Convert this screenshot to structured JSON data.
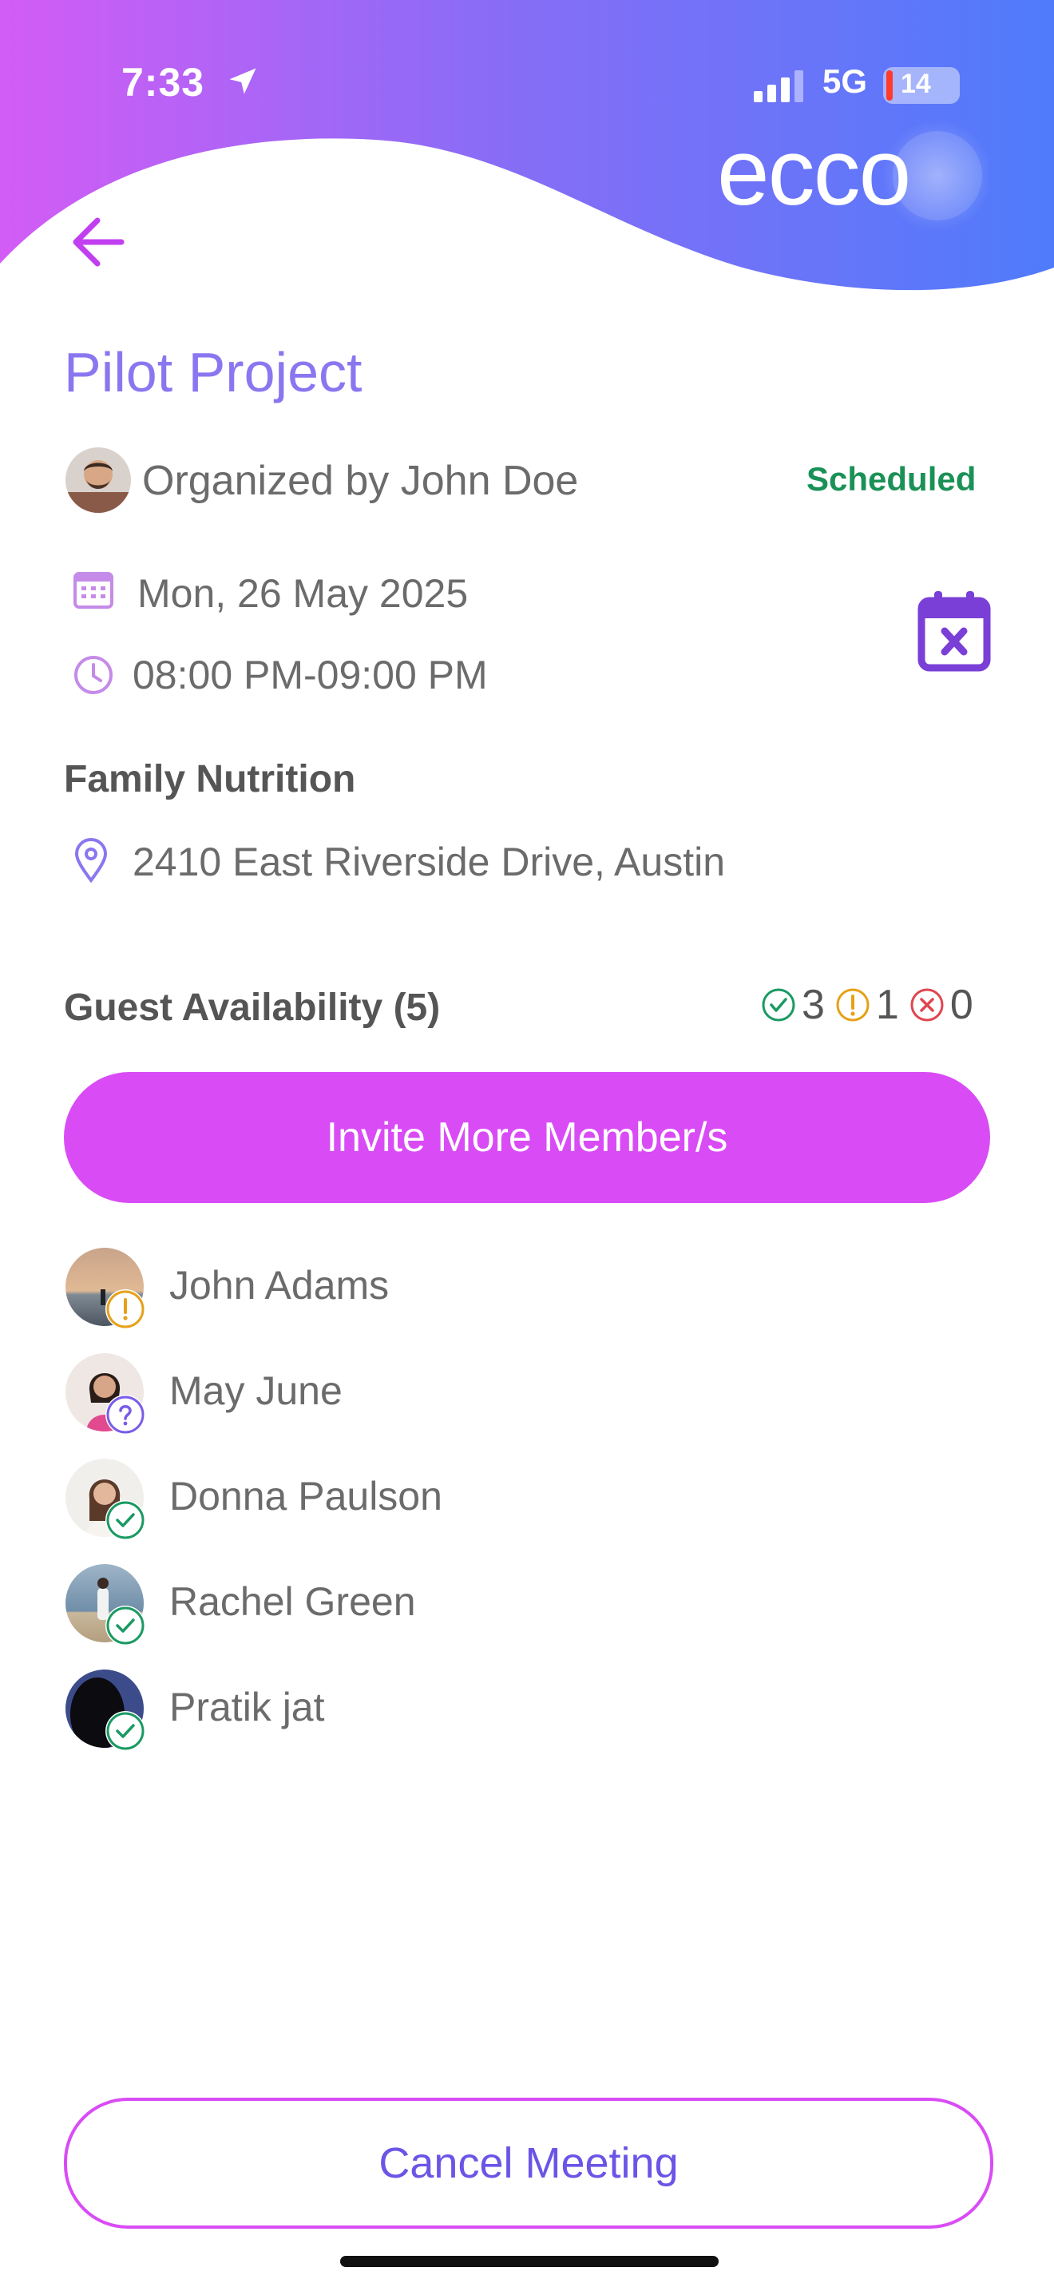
{
  "status_bar": {
    "time": "7:33",
    "network": "5G",
    "battery": "14"
  },
  "header": {
    "logo_text": "ecco",
    "back_icon": "arrow-left-icon"
  },
  "event": {
    "title": "Pilot Project",
    "organizer": "Organized by John Doe",
    "status": "Scheduled",
    "date": "Mon, 26 May 2025",
    "time": "08:00 PM-09:00 PM",
    "category": "Family Nutrition",
    "address": "2410 East Riverside Drive, Austin"
  },
  "guests": {
    "title": "Guest Availability (5)",
    "summary": {
      "accepted": "3",
      "maybe": "1",
      "declined": "0"
    },
    "invite_label": "Invite More Member/s",
    "list": [
      {
        "name": "John Adams",
        "status": "maybe"
      },
      {
        "name": "May June",
        "status": "pending"
      },
      {
        "name": "Donna Paulson",
        "status": "accepted"
      },
      {
        "name": "Rachel Green",
        "status": "accepted"
      },
      {
        "name": "Pratik jat",
        "status": "accepted"
      }
    ]
  },
  "footer": {
    "cancel_label": "Cancel Meeting"
  },
  "colors": {
    "gradient_start": "#d35cf5",
    "gradient_end": "#4f7bfb",
    "accent": "#d94cf5",
    "title": "#8b76f0",
    "scheduled": "#1a9156",
    "accepted": "#1a9a63",
    "maybe": "#e6a019",
    "declined": "#e0454f",
    "pending": "#7a5ce8"
  }
}
